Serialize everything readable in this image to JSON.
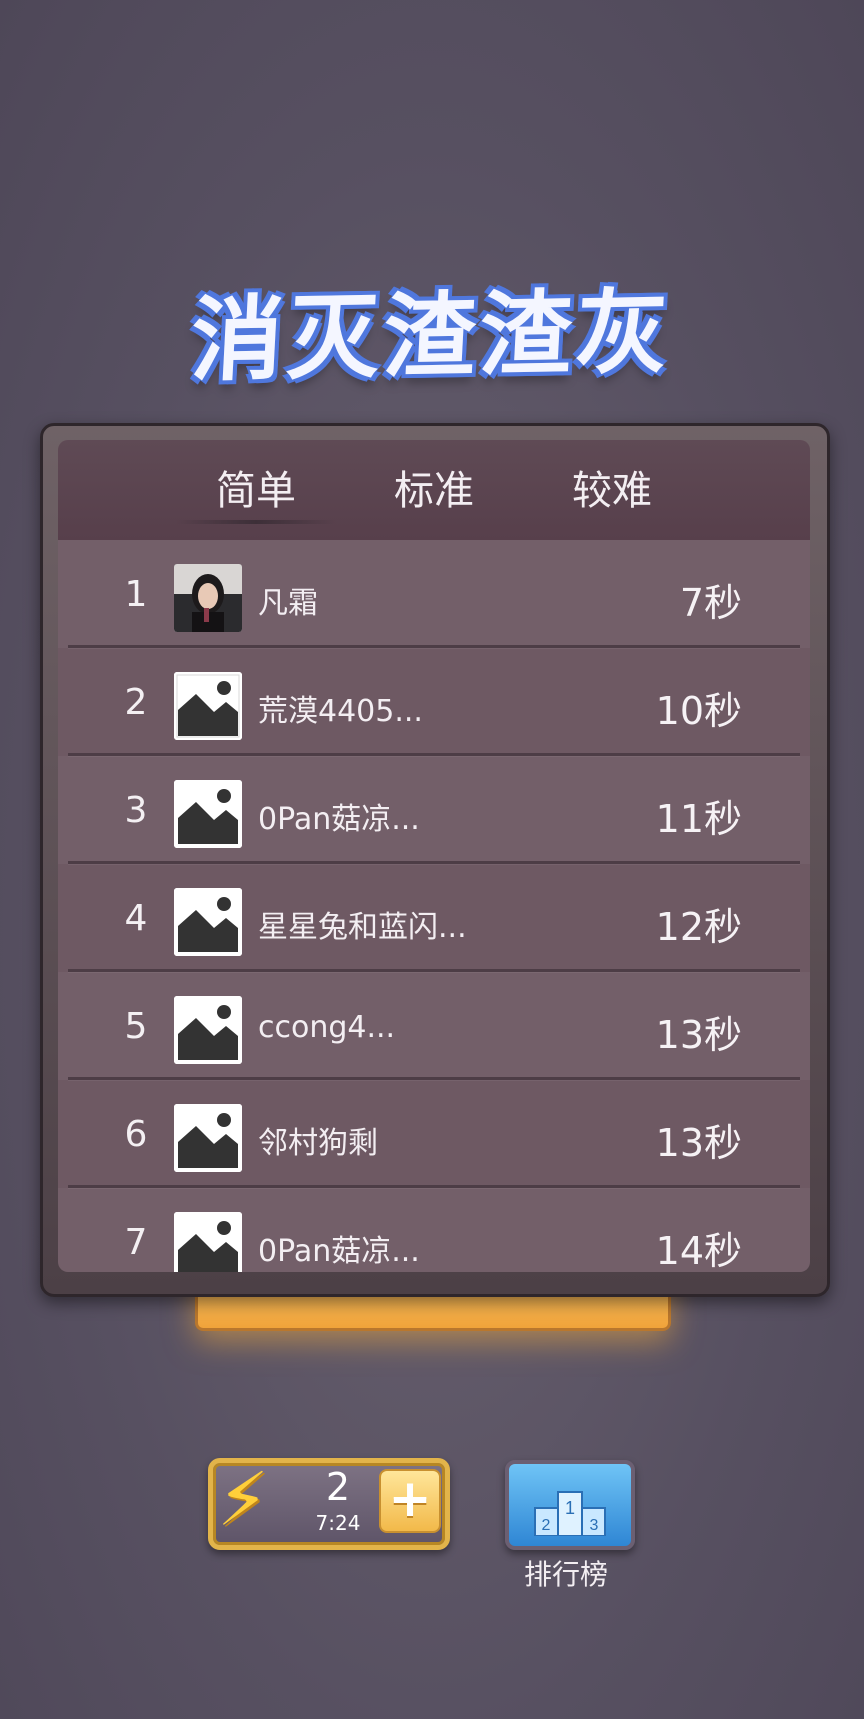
{
  "title": "消灭渣渣灰",
  "tabs": [
    {
      "label": "简单",
      "active": true
    },
    {
      "label": "标准",
      "active": false
    },
    {
      "label": "较难",
      "active": false
    }
  ],
  "leaderboard": [
    {
      "rank": "1",
      "name": "凡霜",
      "time": "7秒",
      "avatar": "photo"
    },
    {
      "rank": "2",
      "name": "荒漠4405...",
      "time": "10秒",
      "avatar": "placeholder-image-icon"
    },
    {
      "rank": "3",
      "name": "0Pan菇凉...",
      "time": "11秒",
      "avatar": "placeholder-image-icon"
    },
    {
      "rank": "4",
      "name": "星星兔和蓝闪...",
      "time": "12秒",
      "avatar": "placeholder-image-icon"
    },
    {
      "rank": "5",
      "name": "ccong4...",
      "time": "13秒",
      "avatar": "placeholder-image-icon"
    },
    {
      "rank": "6",
      "name": "邻村狗剩",
      "time": "13秒",
      "avatar": "placeholder-image-icon"
    },
    {
      "rank": "7",
      "name": "0Pan菇凉...",
      "time": "14秒",
      "avatar": "placeholder-image-icon"
    }
  ],
  "energy": {
    "count": "2",
    "timer": "7:24",
    "icon": "lightning-icon",
    "add_icon": "plus-icon"
  },
  "ranking_button": {
    "label": "排行榜",
    "icon": "podium-icon",
    "podium_numbers": [
      "1",
      "2",
      "3"
    ]
  },
  "colors": {
    "panel": "#6e5963",
    "title_outline": "#4f77dd",
    "energy_border": "#e2b44a",
    "ranking_blue": "#2f86d4"
  }
}
